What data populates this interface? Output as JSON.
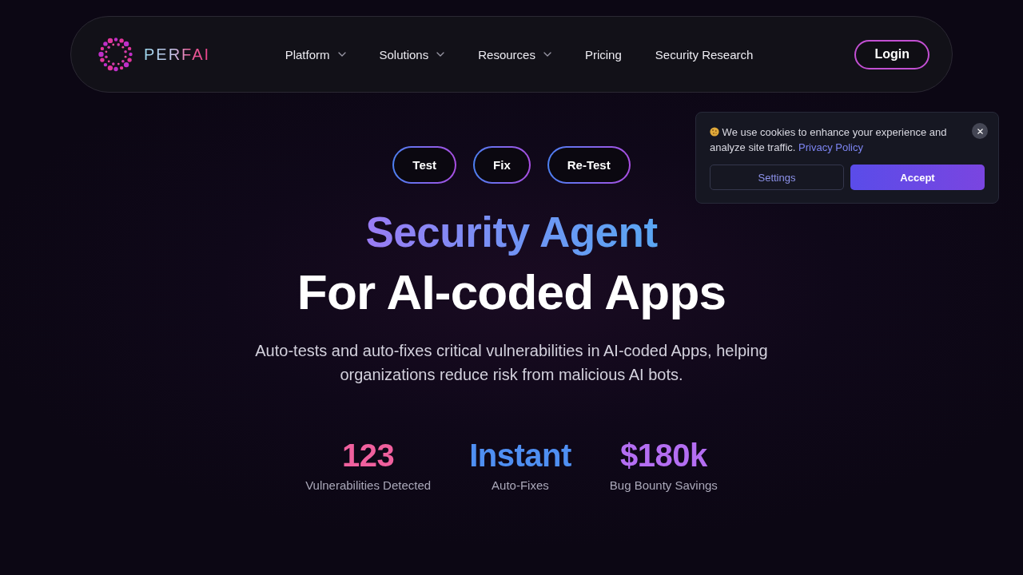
{
  "nav": {
    "logo": {
      "text": "PERFAI"
    },
    "items": [
      {
        "label": "Platform",
        "dropdown": true
      },
      {
        "label": "Solutions",
        "dropdown": true
      },
      {
        "label": "Resources",
        "dropdown": true
      },
      {
        "label": "Pricing",
        "dropdown": false
      },
      {
        "label": "Security Research",
        "dropdown": false
      }
    ],
    "login_button": "Login"
  },
  "hero": {
    "tags": [
      "Test",
      "Fix",
      "Re-Test"
    ],
    "title_line_1": "Security Agent",
    "title_line_2": "For AI-coded Apps",
    "subtitle": "Auto-tests and auto-fixes critical vulnerabilities in AI-coded Apps, helping organizations reduce risk from malicious AI bots.",
    "stats": [
      {
        "value": "123",
        "label": "Vulnerabilities Detected",
        "color": "#f0609e"
      },
      {
        "value": "Instant",
        "label": "Auto-Fixes",
        "color": "#4f8ff2"
      },
      {
        "value": "$180k",
        "label": "Bug Bounty Savings",
        "color": "#b46ef2"
      }
    ]
  },
  "cookie_banner": {
    "message": "We use cookies to enhance your experience and analyze site traffic.",
    "link": "Privacy Policy",
    "settings_button": "Settings",
    "accept_button": "Accept"
  }
}
